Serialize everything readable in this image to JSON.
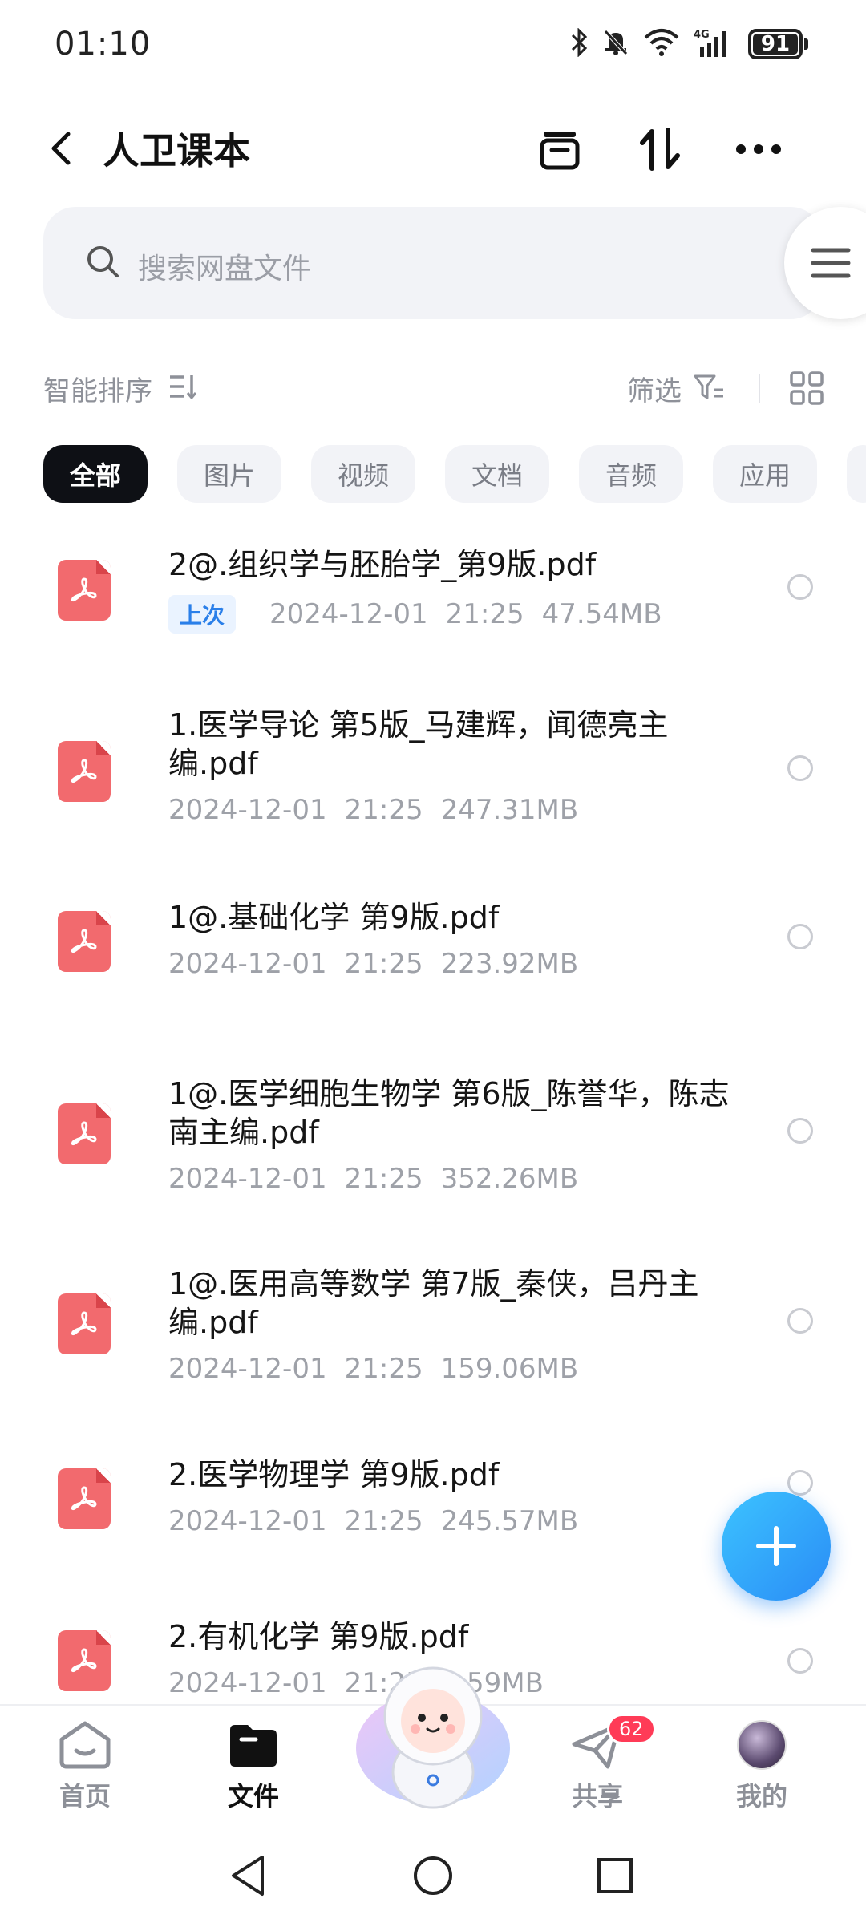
{
  "status_bar": {
    "time": "01:10",
    "battery": "91",
    "network": "4G"
  },
  "header": {
    "title": "人卫课本"
  },
  "search": {
    "placeholder": "搜索网盘文件"
  },
  "sort_bar": {
    "sort_label": "智能排序",
    "filter_label": "筛选"
  },
  "tabs": [
    {
      "label": "全部",
      "active": true
    },
    {
      "label": "图片",
      "active": false
    },
    {
      "label": "视频",
      "active": false
    },
    {
      "label": "文档",
      "active": false
    },
    {
      "label": "音频",
      "active": false
    },
    {
      "label": "应用",
      "active": false
    }
  ],
  "files": [
    {
      "name": "2@.组织学与胚胎学_第9版.pdf",
      "tag": "上次",
      "date": "2024-12-01",
      "time": "21:25",
      "size": "47.54MB"
    },
    {
      "name": "1.医学导论 第5版_马建辉，闻德亮主编.pdf",
      "tag": "",
      "date": "2024-12-01",
      "time": "21:25",
      "size": "247.31MB"
    },
    {
      "name": "1@.基础化学 第9版.pdf",
      "tag": "",
      "date": "2024-12-01",
      "time": "21:25",
      "size": "223.92MB"
    },
    {
      "name": "1@.医学细胞生物学 第6版_陈誉华，陈志南主编.pdf",
      "tag": "",
      "date": "2024-12-01",
      "time": "21:25",
      "size": "352.26MB"
    },
    {
      "name": "1@.医用高等数学 第7版_秦侠，吕丹主编.pdf",
      "tag": "",
      "date": "2024-12-01",
      "time": "21:25",
      "size": "159.06MB"
    },
    {
      "name": "2.医学物理学 第9版.pdf",
      "tag": "",
      "date": "2024-12-01",
      "time": "21:25",
      "size": "245.57MB"
    },
    {
      "name": "2.有机化学 第9版.pdf",
      "tag": "",
      "date": "2024-12-01",
      "time": "21:25",
      "size": "1.59MB"
    }
  ],
  "bottom_nav": {
    "home": "首页",
    "files": "文件",
    "share": "共享",
    "share_badge": "62",
    "mine": "我的"
  },
  "colors": {
    "accent_blue": "#2a8cf6",
    "pdf_red": "#f26a6e",
    "badge_red": "#ff3b57"
  }
}
